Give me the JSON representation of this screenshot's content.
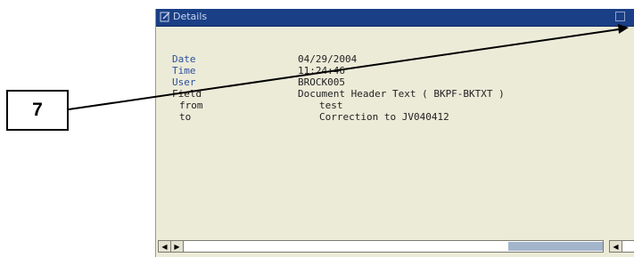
{
  "callout": {
    "number": "7"
  },
  "window": {
    "title": "Details",
    "icons": {
      "title": "edit-document-icon",
      "close": "close-icon"
    }
  },
  "details": {
    "rows": [
      {
        "label": "Date",
        "value": "04/29/2004"
      },
      {
        "label": "Time",
        "value": "11:24:46"
      },
      {
        "label": "User",
        "value": "BROCK005"
      },
      {
        "label": "Field",
        "value": "Document Header Text ( BKPF-BKTXT )"
      },
      {
        "label": "from",
        "value": "test"
      },
      {
        "label": "to",
        "value": "Correction to JV040412"
      }
    ]
  },
  "scrollbar": {
    "left_arrow": "◀",
    "right_arrow": "▶"
  },
  "colors": {
    "titlebar": "#1a3f86",
    "window_bg": "#ecebd8",
    "label_blue": "#2c4f9e"
  }
}
